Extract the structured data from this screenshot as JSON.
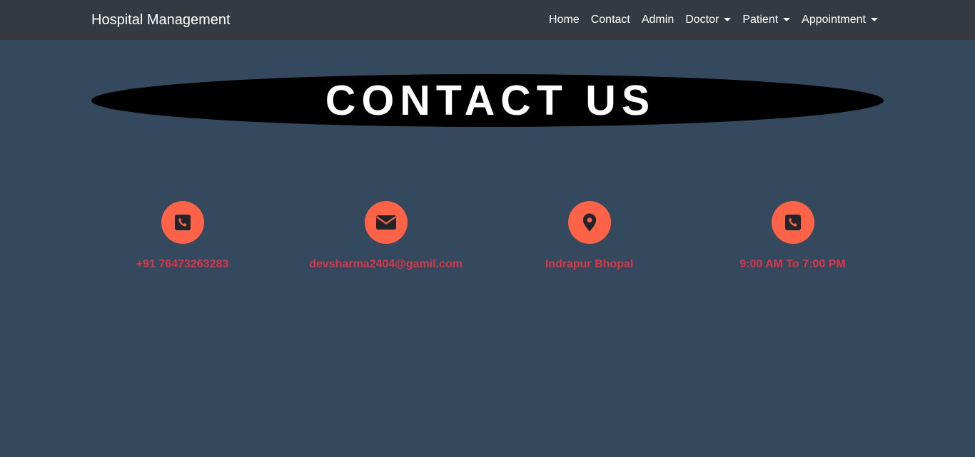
{
  "navbar": {
    "brand": "Hospital Management",
    "links": [
      {
        "label": "Home",
        "dropdown": false
      },
      {
        "label": "Contact",
        "dropdown": false
      },
      {
        "label": "Admin",
        "dropdown": false
      },
      {
        "label": "Doctor",
        "dropdown": true
      },
      {
        "label": "Patient",
        "dropdown": true
      },
      {
        "label": "Appointment",
        "dropdown": true
      }
    ]
  },
  "hero": {
    "title": "CONTACT US"
  },
  "contacts": [
    {
      "icon": "phone-square-icon",
      "text": "+91 76473263283"
    },
    {
      "icon": "envelope-icon",
      "text": "devsharma2404@gamil.com"
    },
    {
      "icon": "map-marker-icon",
      "text": "Indrapur Bhopal"
    },
    {
      "icon": "phone-square-icon",
      "text": "9:00 AM To 7:00 PM"
    }
  ],
  "colors": {
    "page_background": "#34495e",
    "navbar_background": "#343a40",
    "icon_circle": "#ff6347",
    "contact_text": "#dc3545",
    "hero_background": "#000000"
  }
}
